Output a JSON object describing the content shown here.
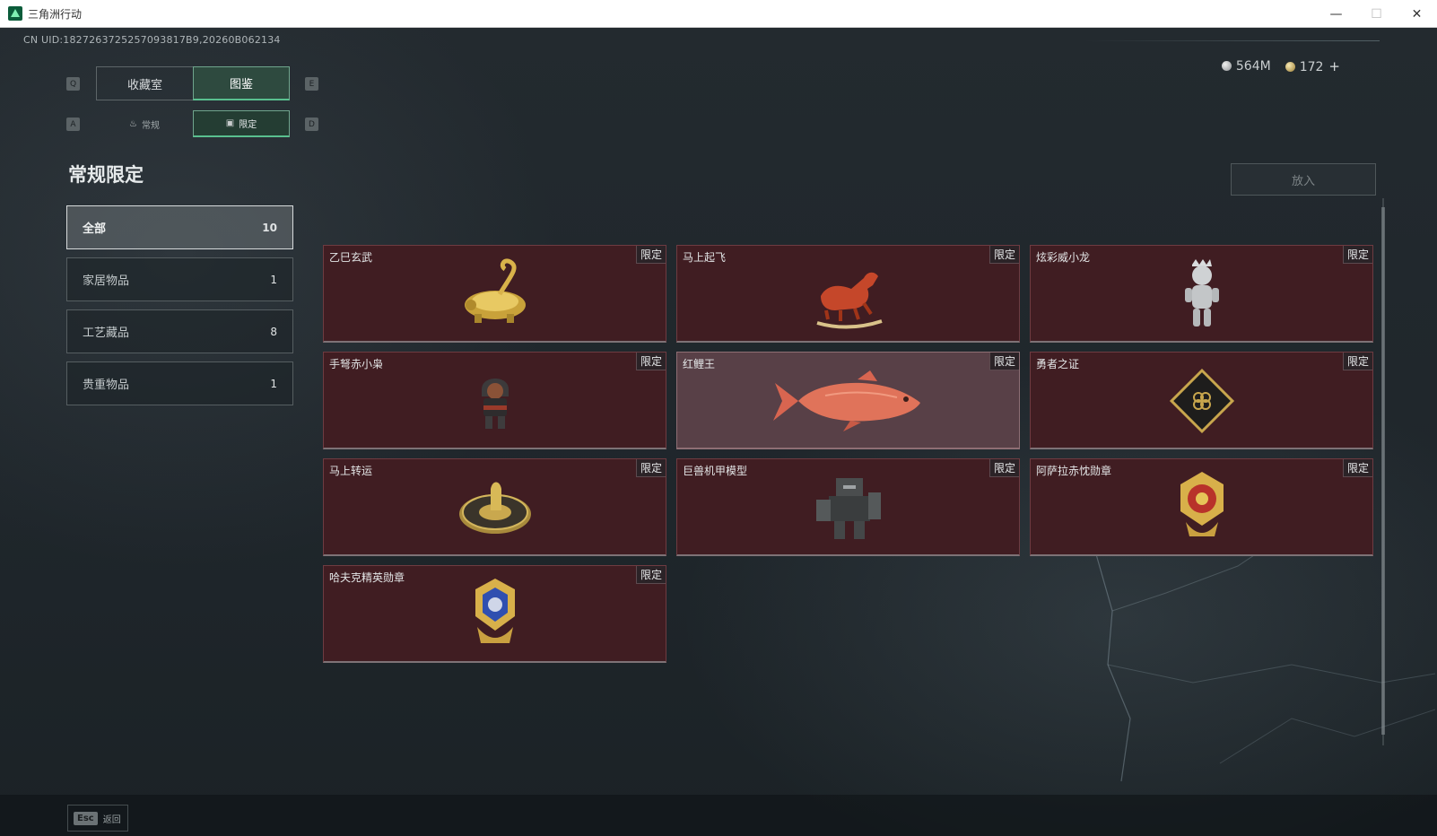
{
  "window": {
    "title": "三角洲行动",
    "minimize_glyph": "—",
    "maximize_glyph": "☐",
    "close_glyph": "✕"
  },
  "uid": "CN UID:1827263725257093817B9,20260B062134",
  "keys": {
    "prev_tab": "Q",
    "next_tab": "E",
    "prev_sub": "A",
    "next_sub": "D"
  },
  "tabs": [
    {
      "label": "收藏室",
      "active": false
    },
    {
      "label": "图鉴",
      "active": true
    }
  ],
  "subtabs": [
    {
      "label": "常规",
      "icon": "flame-icon",
      "active": false
    },
    {
      "label": "限定",
      "icon": "picture-icon",
      "active": true
    }
  ],
  "currency": {
    "silver": "564M",
    "gold": "172",
    "plus": "+"
  },
  "section_title": "常规限定",
  "categories": [
    {
      "label": "全部",
      "count": "10",
      "active": true
    },
    {
      "label": "家居物品",
      "count": "1",
      "active": false
    },
    {
      "label": "工艺藏品",
      "count": "8",
      "active": false
    },
    {
      "label": "贵重物品",
      "count": "1",
      "active": false
    }
  ],
  "put_button": "放入",
  "items": [
    {
      "name": "乙巳玄武",
      "badge": "限定",
      "icon": "golden-dragon-turtle-icon"
    },
    {
      "name": "马上起飞",
      "badge": "限定",
      "icon": "red-horse-icon"
    },
    {
      "name": "炫彩威小龙",
      "badge": "限定",
      "icon": "silver-figurine-icon"
    },
    {
      "name": "手弩赤小枭",
      "badge": "限定",
      "icon": "hooded-figure-icon"
    },
    {
      "name": "红鲤王",
      "badge": "限定",
      "icon": "red-carp-icon"
    },
    {
      "name": "勇者之证",
      "badge": "限定",
      "icon": "black-card-icon"
    },
    {
      "name": "马上转运",
      "badge": "限定",
      "icon": "golden-wheel-icon"
    },
    {
      "name": "巨兽机甲模型",
      "badge": "限定",
      "icon": "mecha-model-icon"
    },
    {
      "name": "阿萨拉赤忱勋章",
      "badge": "限定",
      "icon": "red-medal-icon"
    },
    {
      "name": "哈夫克精英勋章",
      "badge": "限定",
      "icon": "blue-medal-icon"
    }
  ],
  "footer": {
    "esc_key": "Esc",
    "back_label": "返回"
  },
  "colors": {
    "accent_green": "#59c08f",
    "card_bg": "#401d22",
    "card_highlight": "#584047"
  }
}
